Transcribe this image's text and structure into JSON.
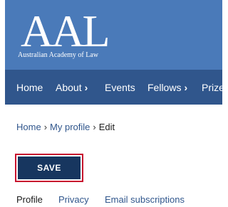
{
  "header": {
    "logo_text": "AAL",
    "logo_subtitle": "Australian Academy of Law",
    "background_color": "#4a7ab9"
  },
  "nav": {
    "background_color": "#30568c",
    "items": [
      {
        "label": "Home",
        "has_submenu": false
      },
      {
        "label": "About",
        "has_submenu": true,
        "chevron": "›"
      },
      {
        "label": "Events",
        "has_submenu": false
      },
      {
        "label": "Fellows",
        "has_submenu": true,
        "chevron": "›"
      },
      {
        "label": "Prize",
        "has_submenu": false
      }
    ]
  },
  "breadcrumb": {
    "items": [
      "Home",
      "My profile"
    ],
    "separator": "›",
    "current": "Edit"
  },
  "save_button": {
    "label": "SAVE",
    "focus_outline_color": "#c8102e",
    "background_color": "#17365f"
  },
  "tabs": [
    {
      "label": "Profile",
      "active": true
    },
    {
      "label": "Privacy",
      "active": false
    },
    {
      "label": "Email subscriptions",
      "active": false
    }
  ]
}
